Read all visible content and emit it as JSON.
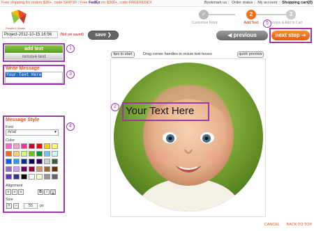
{
  "promo": {
    "text_a": "Free shipping for orders $30+, code SHIP30",
    "text_b": "Free",
    "fedex": "FedEx",
    "text_c": "on $300+, code FREEFEDEX"
  },
  "topnav": {
    "bookmark": "Bookmark us",
    "order_status": "Order status",
    "account": "My account",
    "cart": "Shopping cart(0)"
  },
  "logo": {
    "text": "Ponder's Studio"
  },
  "steps": [
    {
      "number": "✓",
      "label": "Customize Front",
      "state": "done"
    },
    {
      "number": "2",
      "label": "Add Text",
      "state": "active"
    },
    {
      "number": "3",
      "label": "Preview & Add to Cart",
      "state": "todo"
    }
  ],
  "project": {
    "name": "Project-2012-10-15 16:56",
    "status": "(Not yet saved)",
    "save_label": "save"
  },
  "nav_buttons": {
    "previous": "◀ previous",
    "next": "next step ➜"
  },
  "left_panel": {
    "add_text": "add text",
    "remove_text": "remove text",
    "write_title": "Write Message",
    "write_value": "Your Text Here",
    "style_title": "Message Style",
    "font_label": "Font",
    "font_value": "Arial",
    "color_label": "Color",
    "colors": [
      "#ff66cc",
      "#ff99cc",
      "#ff3399",
      "#cc0033",
      "#ff0000",
      "#ffcc00",
      "#ffff66",
      "#ff6600",
      "#ffcc66",
      "#ccff66",
      "#66cc00",
      "#009933",
      "#66ccff",
      "#ccffff",
      "#0066ff",
      "#3399ff",
      "#003399",
      "#000066",
      "#330066",
      "#cccccc",
      "#336633",
      "#9966cc",
      "#cc99ff",
      "#660066",
      "#990033",
      "#cc9966",
      "#996633",
      "#663300",
      "#6633cc",
      "#333399",
      "#000000",
      "#ffffff",
      "#ffffcc",
      "#999999",
      "#666666"
    ],
    "alignment_label": "Alignment",
    "align_icons": [
      "≡",
      "≡",
      "≡"
    ],
    "style_icons": [
      "B",
      "I",
      "U"
    ],
    "size_label": "Size",
    "size_value": "55",
    "size_unit": "px"
  },
  "canvas": {
    "tips": "tips to start",
    "hint": "Drag corner handles to resize text boxes",
    "quick_preview": "quick preview",
    "text": "Your Text Here"
  },
  "annotations": [
    "1",
    "2",
    "3",
    "4",
    "5"
  ],
  "footer": {
    "cancel": "CANCEL",
    "back": "BACK TO TOP"
  }
}
